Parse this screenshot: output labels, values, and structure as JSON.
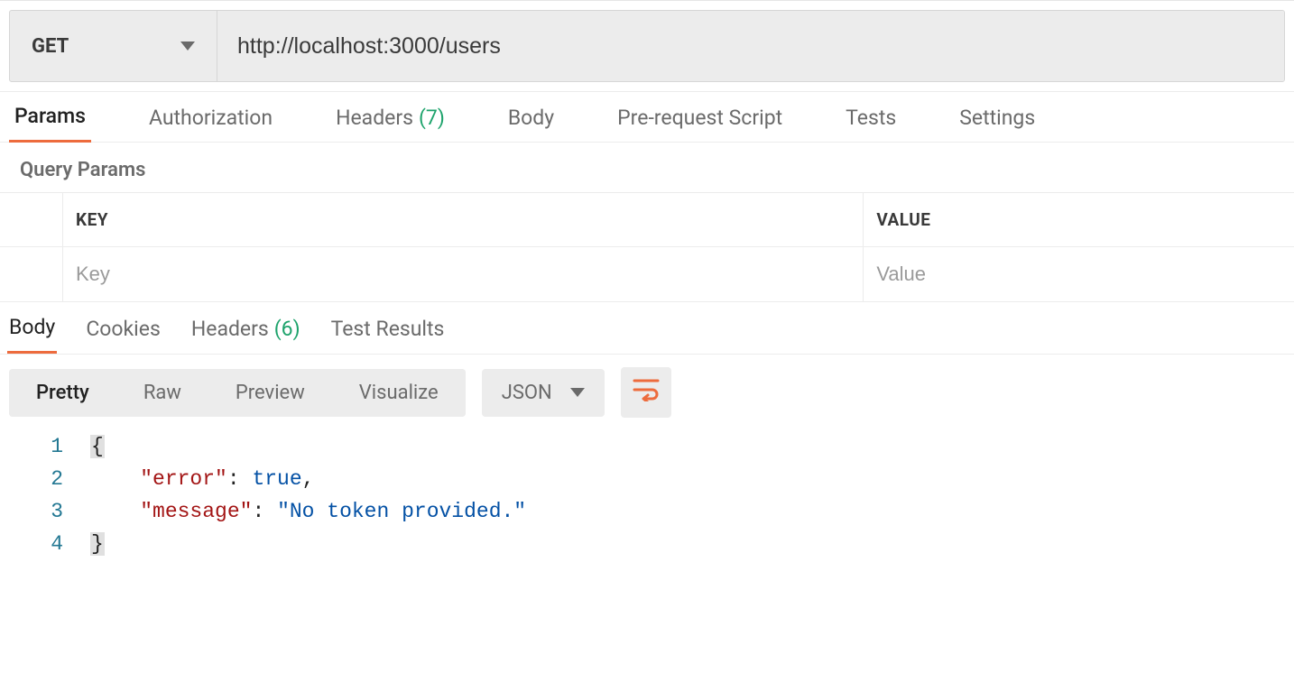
{
  "request": {
    "method": "GET",
    "url": "http://localhost:3000/users"
  },
  "request_tabs": {
    "params": "Params",
    "authorization": "Authorization",
    "headers": "Headers",
    "headers_count": "(7)",
    "body": "Body",
    "prerequest": "Pre-request Script",
    "tests": "Tests",
    "settings": "Settings"
  },
  "query_params": {
    "title": "Query Params",
    "key_header": "KEY",
    "value_header": "VALUE",
    "key_placeholder": "Key",
    "value_placeholder": "Value"
  },
  "response_tabs": {
    "body": "Body",
    "cookies": "Cookies",
    "headers": "Headers",
    "headers_count": "(6)",
    "test_results": "Test Results"
  },
  "body_view": {
    "pretty": "Pretty",
    "raw": "Raw",
    "preview": "Preview",
    "visualize": "Visualize",
    "format": "JSON"
  },
  "response_body": {
    "lines": [
      "1",
      "2",
      "3",
      "4"
    ],
    "open_brace": "{",
    "close_brace": "}",
    "error_key": "\"error\"",
    "error_val": "true",
    "comma": ",",
    "colon": ": ",
    "message_key": "\"message\"",
    "message_val": "\"No token provided.\""
  }
}
